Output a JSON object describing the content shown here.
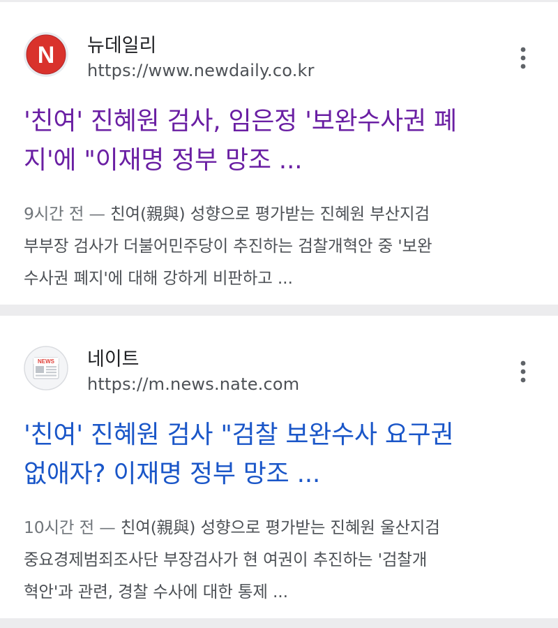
{
  "results": [
    {
      "source_name": "뉴데일리",
      "source_url": "https://www.newdaily.co.kr",
      "favicon": "newdaily-logo-icon",
      "favicon_letter": "N",
      "title_line1": "'친여' 진혜원 검사, 임은정 '보완수사권 폐",
      "title_line2": "지'에 \"이재명 정부 망조 ...",
      "title_color": "#6a1fa3",
      "snippet_time": "9시간 전 — ",
      "snippet_line1": "친여(親與) 성향으로 평가받는 진혜원 부산지검",
      "snippet_line2": "부부장 검사가 더불어민주당이 추진하는 검찰개혁안 중 '보완",
      "snippet_line3": "수사권 폐지'에 대해 강하게 비판하고 ..."
    },
    {
      "source_name": "네이트",
      "source_url": "https://m.news.nate.com",
      "favicon": "nate-news-icon",
      "favicon_label": "NEWS",
      "title_line1": "'친여' 진혜원 검사 \"검찰 보완수사 요구권",
      "title_line2": "없애자? 이재명 정부 망조 ...",
      "title_color": "#1a56c8",
      "snippet_time": "10시간 전 — ",
      "snippet_line1": "친여(親與) 성향으로 평가받는 진혜원 울산지검",
      "snippet_line2": "중요경제범죄조사단 부장검사가 현 여권이 추진하는 '검찰개",
      "snippet_line3": "혁안'과 관련, 경찰 수사에 대한 통제 ..."
    }
  ],
  "icons": {
    "more": "more-vert-icon"
  }
}
